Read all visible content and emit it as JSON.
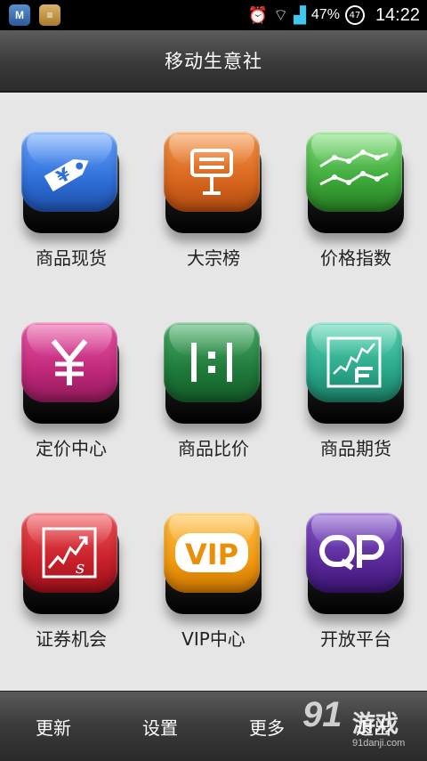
{
  "status_bar": {
    "battery_percent": "47%",
    "battery_ring": "47",
    "time": "14:22",
    "left_icons": [
      "m-app-icon",
      "burger-app-icon"
    ],
    "right_icons": [
      "alarm-icon",
      "wifi-icon",
      "signal-icon"
    ]
  },
  "header": {
    "title": "移动生意社"
  },
  "grid": {
    "items": [
      {
        "label": "商品现货",
        "icon": "price-tag-icon",
        "color": "#2f6fd8"
      },
      {
        "label": "大宗榜",
        "icon": "billboard-icon",
        "color": "#d8661e"
      },
      {
        "label": "价格指数",
        "icon": "line-chart-icon",
        "color": "#3ea83a"
      },
      {
        "label": "定价中心",
        "icon": "yen-icon",
        "color": "#c0287a"
      },
      {
        "label": "商品比价",
        "icon": "ratio-icon",
        "color": "#1f7a3a"
      },
      {
        "label": "商品期货",
        "icon": "futures-chart-icon",
        "color": "#2aa88a"
      },
      {
        "label": "证券机会",
        "icon": "stock-chart-icon",
        "color": "#c8202a"
      },
      {
        "label": "VIP中心",
        "icon": "vip-icon",
        "color": "#f29a10"
      },
      {
        "label": "开放平台",
        "icon": "op-icon",
        "color": "#5a2a9a"
      }
    ]
  },
  "bottom_bar": {
    "items": [
      "更新",
      "设置",
      "更多",
      "退出"
    ]
  },
  "watermark": {
    "big": "91",
    "cn": "游戏",
    "url": "91danji.com"
  }
}
